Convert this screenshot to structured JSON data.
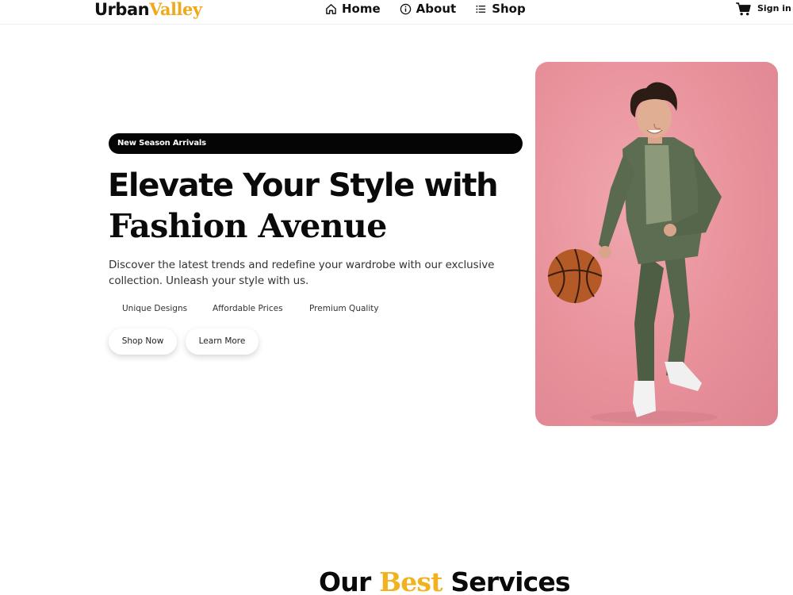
{
  "header": {
    "logo_part1": "Urban",
    "logo_part2": "Valley",
    "nav": [
      {
        "label": "Home",
        "icon": "home-icon"
      },
      {
        "label": "About",
        "icon": "info-icon"
      },
      {
        "label": "Shop",
        "icon": "list-icon"
      }
    ],
    "cart_icon": "cart-icon",
    "signin_label": "Sign in"
  },
  "hero": {
    "badge": "New Season Arrivals",
    "headline_line1": "Elevate Your Style with",
    "headline_line2": "Fashion Avenue",
    "description": "Discover the latest trends and redefine your wardrobe with our exclusive collection. Unleash your style with us.",
    "features": [
      "Unique Designs",
      "Affordable Prices",
      "Premium Quality"
    ],
    "buttons": {
      "shop": "Shop Now",
      "learn": "Learn More"
    }
  },
  "services": {
    "title_before": "Our",
    "title_accent": "Best",
    "title_after": "Services"
  },
  "colors": {
    "accent": "#f1a91c",
    "hero_bg": "#e8919b",
    "badge_bg": "#050505"
  }
}
